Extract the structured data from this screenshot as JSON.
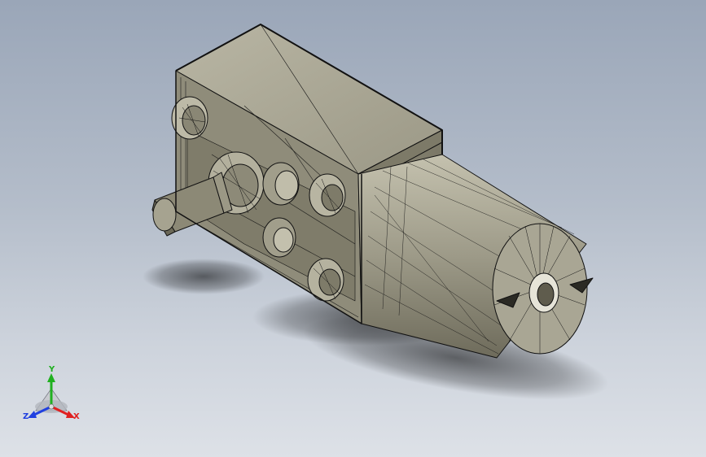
{
  "colors": {
    "background_top": "#9aa6b8",
    "background_bottom": "#dde1e7",
    "model_face_light": "#a9a694",
    "model_face_mid": "#8e8b79",
    "model_face_dark": "#6a6757",
    "edge_color": "#111111",
    "axis_x": "#e02020",
    "axis_y": "#20b020",
    "axis_z": "#2040e0"
  },
  "triad": {
    "x_label": "X",
    "y_label": "Y",
    "z_label": "Z"
  },
  "model": {
    "name_icon": "worm-gear-motor-wireframe"
  }
}
